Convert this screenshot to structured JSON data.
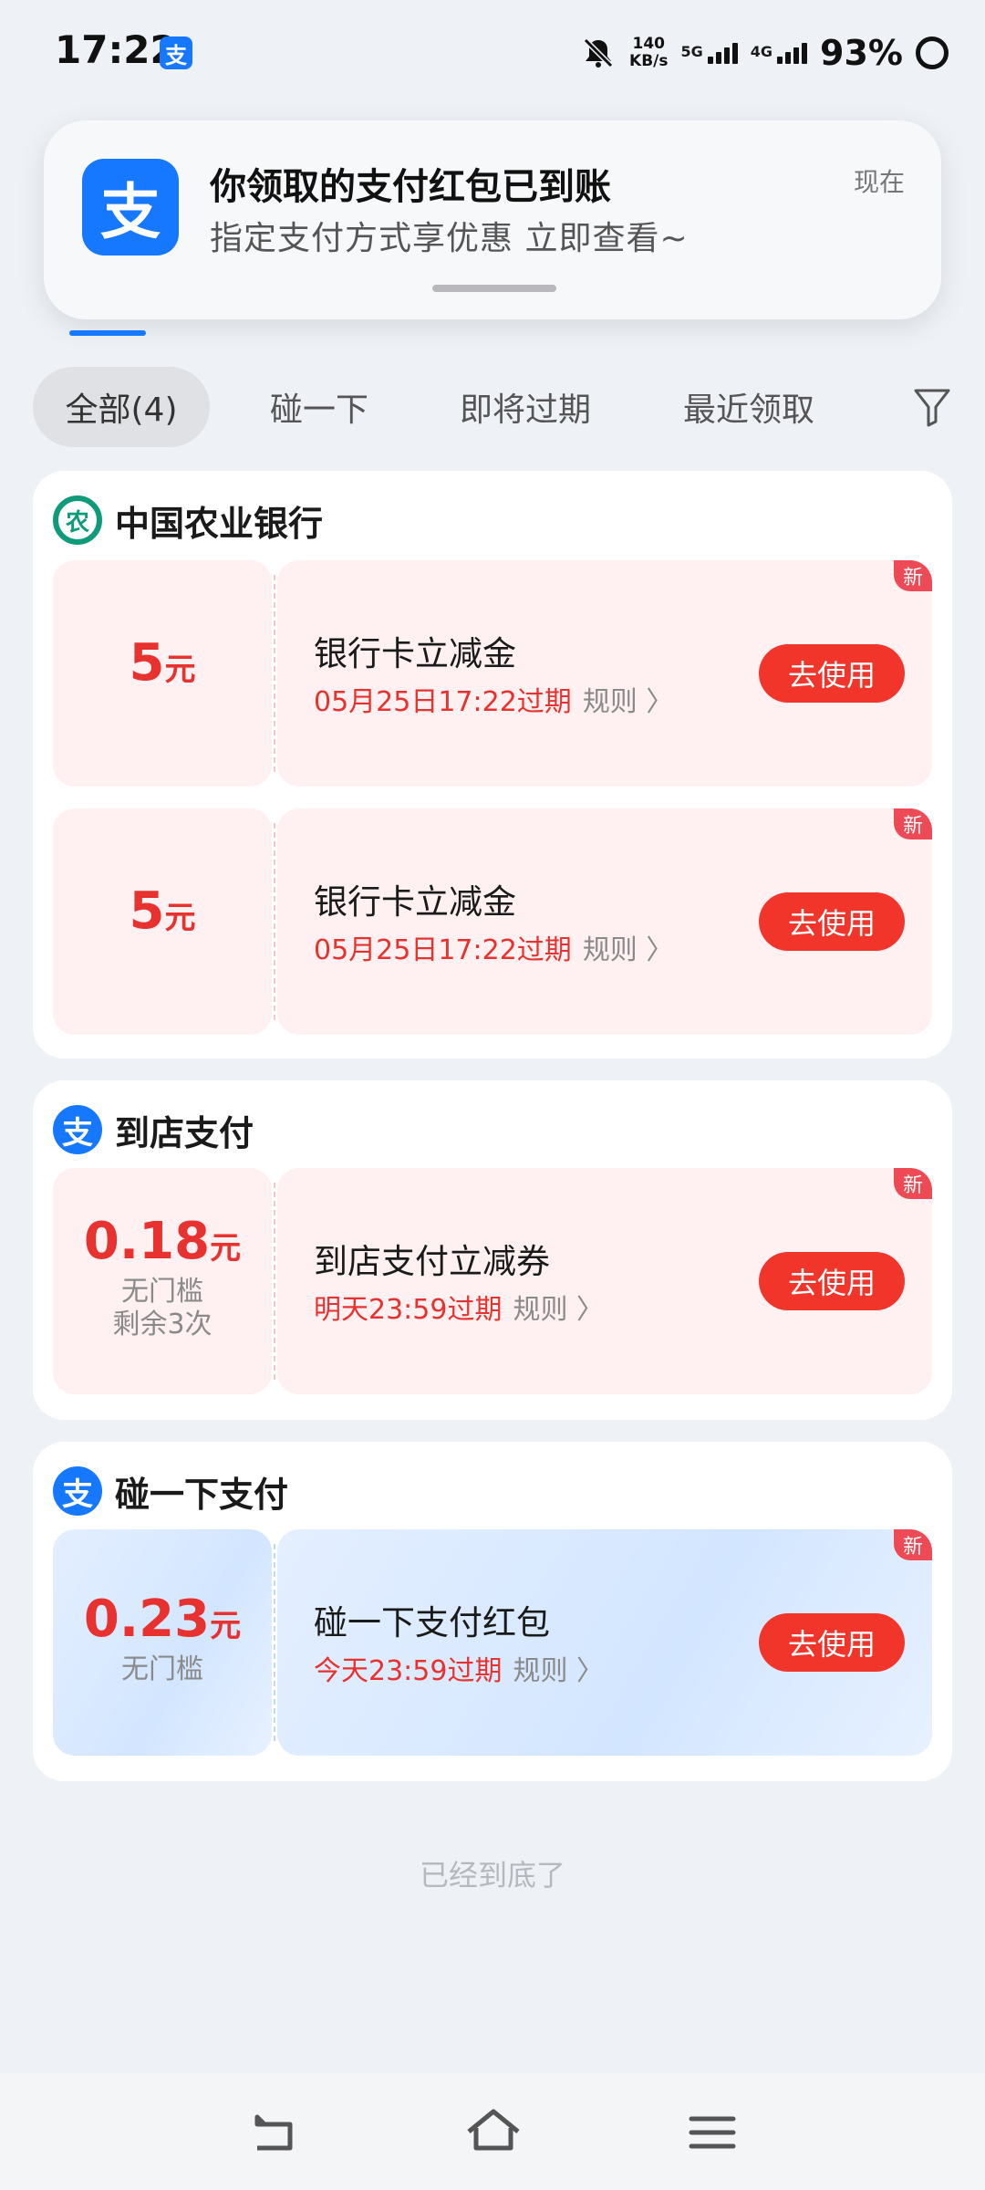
{
  "status_bar": {
    "time": "17:22",
    "app_icon_glyph": "支",
    "speed_value": "140",
    "speed_unit": "KB/s",
    "net1": "5G",
    "net2": "4G",
    "battery": "93%"
  },
  "notification": {
    "icon_glyph": "支",
    "title": "你领取的支付红包已到账",
    "body": "指定支付方式享优惠 立即查看~",
    "time": "现在"
  },
  "filters": [
    {
      "label": "全部(4)",
      "active": true
    },
    {
      "label": "碰一下",
      "active": false
    },
    {
      "label": "即将过期",
      "active": false
    },
    {
      "label": "最近领取",
      "active": false
    }
  ],
  "groups": [
    {
      "title": "中国农业银行",
      "logo_glyph": "农",
      "coupons": [
        {
          "amount": "5",
          "unit": "元",
          "name": "银行卡立减金",
          "expire": "05月25日17:22过期",
          "rule": "规则 〉",
          "button": "去使用",
          "badge": "新"
        },
        {
          "amount": "5",
          "unit": "元",
          "name": "银行卡立减金",
          "expire": "05月25日17:22过期",
          "rule": "规则 〉",
          "button": "去使用",
          "badge": "新"
        }
      ]
    },
    {
      "title": "到店支付",
      "logo_glyph": "支",
      "coupons": [
        {
          "amount": "0.18",
          "unit": "元",
          "sub1": "无门槛",
          "sub2": "剩余3次",
          "name": "到店支付立减券",
          "expire": "明天23:59过期",
          "rule": "规则 〉",
          "button": "去使用",
          "badge": "新"
        }
      ]
    },
    {
      "title": "碰一下支付",
      "logo_glyph": "支",
      "coupons": [
        {
          "amount": "0.23",
          "unit": "元",
          "sub1": "无门槛",
          "name": "碰一下支付红包",
          "expire": "今天23:59过期",
          "rule": "规则 〉",
          "button": "去使用",
          "badge": "新"
        }
      ]
    }
  ],
  "footer_text": "已经到底了",
  "icons": [
    "mute-bell-icon",
    "filter-icon",
    "back-icon",
    "home-icon",
    "menu-icon"
  ],
  "colors": {
    "accent": "#1677ff",
    "red": "#e8322f",
    "button": "#f2352b"
  }
}
